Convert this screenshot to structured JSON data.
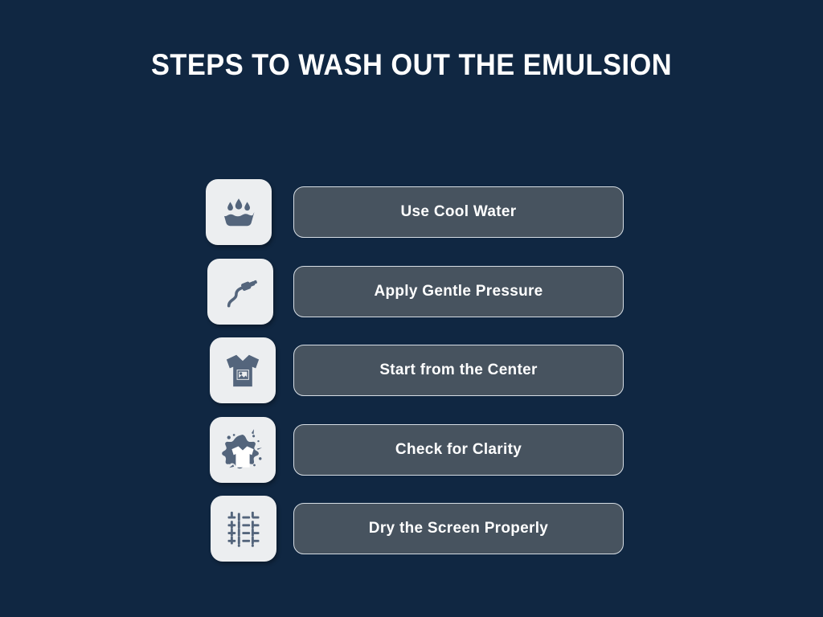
{
  "page": {
    "background_color": "#102742",
    "title": "STEPS TO WASH OUT THE EMULSION"
  },
  "theme": {
    "title_color": "#ffffff",
    "tile_background": "#eceef0",
    "icon_color": "#54657c",
    "button_fill": "#47535f",
    "button_border": "#d6dde4",
    "button_text_color": "#ffffff"
  },
  "steps": [
    {
      "label": "Use Cool Water",
      "icon": "wash-basin-icon"
    },
    {
      "label": "Apply Gentle Pressure",
      "icon": "hose-nozzle-icon"
    },
    {
      "label": "Start from the Center",
      "icon": "printed-tshirt-icon"
    },
    {
      "label": "Check for Clarity",
      "icon": "ink-splatter-tshirt-icon"
    },
    {
      "label": "Dry the Screen Properly",
      "icon": "woven-mesh-screen-icon"
    }
  ]
}
